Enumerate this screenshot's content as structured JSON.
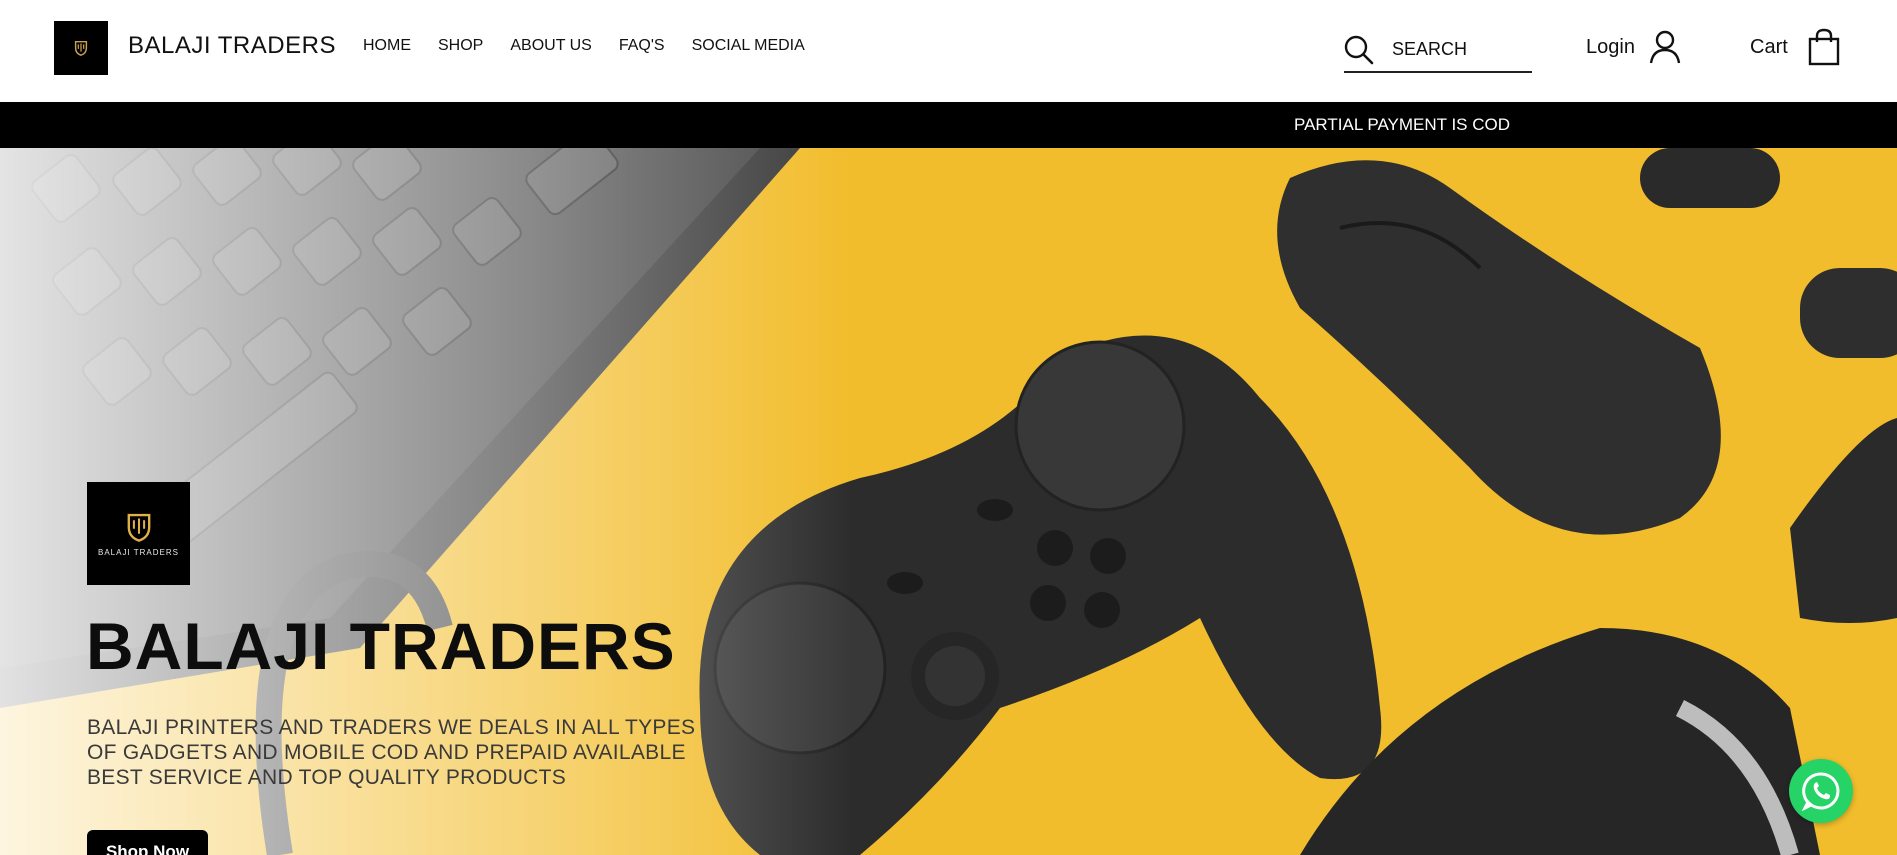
{
  "header": {
    "brand": "BALAJI TRADERS",
    "logo_text": "BALAJI TRADERS",
    "nav": [
      {
        "label": "HOME"
      },
      {
        "label": "SHOP"
      },
      {
        "label": "ABOUT US"
      },
      {
        "label": "FAQ'S"
      },
      {
        "label": "SOCIAL MEDIA"
      }
    ],
    "search_placeholder": "SEARCH",
    "login_label": "Login",
    "cart_label": "Cart",
    "icons": [
      "search-icon",
      "user-icon",
      "shopping-bag-icon"
    ]
  },
  "announcement": {
    "text": "PARTIAL PAYMENT IS COD"
  },
  "hero": {
    "logo_text": "BALAJI TRADERS",
    "title": "BALAJI TRADERS",
    "description": "BALAJI PRINTERS AND TRADERS WE DEALS IN ALL TYPES OF GADGETS AND MOBILE COD AND PREPAID AVAILABLE BEST SERVICE AND TOP QUALITY PRODUCTS",
    "cta_label": "Shop Now",
    "background_color": "#f2bd2c"
  },
  "floating": {
    "icon": "whatsapp-icon",
    "color": "#25d366"
  }
}
